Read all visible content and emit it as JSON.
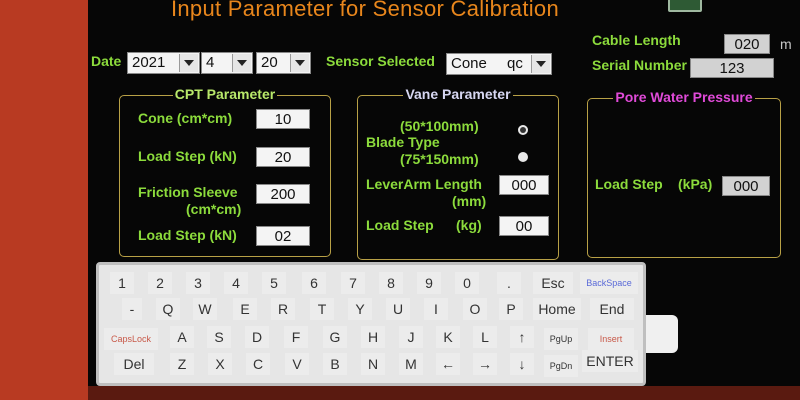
{
  "title": "Input Parameter for Sensor Calibration",
  "colors": {
    "label_green": "#8cdb3c",
    "title_orange": "#e8861c",
    "vane_title": "#d7d7f2",
    "pore_title": "#e04ad8"
  },
  "date": {
    "label": "Date",
    "year": "2021",
    "month": "4",
    "day": "20"
  },
  "sensor": {
    "label": "Sensor Selected",
    "value": "Cone",
    "value2": "qc"
  },
  "cable": {
    "label": "Cable Length",
    "value": "020",
    "unit": "m"
  },
  "serial": {
    "label": "Serial Number",
    "value": "123"
  },
  "cpt": {
    "title": "CPT Parameter",
    "cone_label": "Cone (cm*cm)",
    "cone_value": "10",
    "load_step_label": "Load Step (kN)",
    "load_step_value": "20",
    "friction_label_1": "Friction Sleeve",
    "friction_label_2": "(cm*cm)",
    "friction_value": "200",
    "load_step2_label": "Load Step (kN)",
    "load_step2_value": "02"
  },
  "vane": {
    "title": "Vane Parameter",
    "size1": "(50*100mm)",
    "blade_type": "Blade Type",
    "size2": "(75*150mm)",
    "lever_label_1": "LeverArm Length",
    "lever_label_2": "(mm)",
    "lever_value": "000",
    "load_step_label": "Load Step",
    "load_step_unit": "(kg)",
    "load_step_value": "00"
  },
  "pore": {
    "title": "Pore Water Pressure",
    "load_step_label": "Load Step",
    "load_step_unit": "(kPa)",
    "load_step_value": "000"
  },
  "keyboard": {
    "row1": [
      "1",
      "2",
      "3",
      "4",
      "5",
      "6",
      "7",
      "8",
      "9",
      "0",
      ".",
      "Esc",
      "BackSpace"
    ],
    "row2": [
      "-",
      "Q",
      "W",
      "E",
      "R",
      "T",
      "Y",
      "U",
      "I",
      "O",
      "P",
      "Home",
      "End"
    ],
    "row3": [
      "CapsLock",
      "A",
      "S",
      "D",
      "F",
      "G",
      "H",
      "J",
      "K",
      "L",
      "↑",
      "PgUp",
      "Insert"
    ],
    "row4": [
      "Del",
      "Z",
      "X",
      "C",
      "V",
      "B",
      "N",
      "M",
      "←",
      "→",
      "↓",
      "PgDn",
      "ENTER"
    ]
  }
}
